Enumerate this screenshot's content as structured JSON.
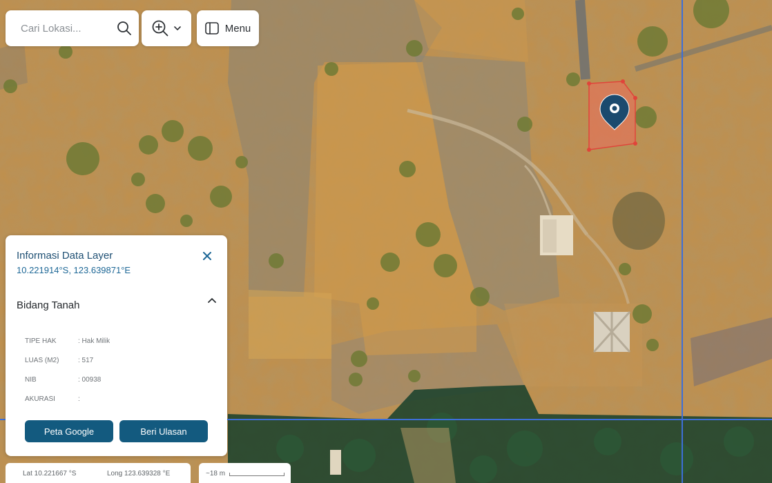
{
  "search": {
    "placeholder": "Cari Lokasi..."
  },
  "toolbar": {
    "menu_label": "Menu"
  },
  "icons": {
    "search": "search-icon",
    "zoom": "zoom-in-icon",
    "dropdown": "chevron-down-icon",
    "sidebar": "sidebar-panel-icon",
    "close": "close-icon",
    "collapse": "chevron-up-icon",
    "marker": "location-pin-icon"
  },
  "panel": {
    "title": "Informasi Data Layer",
    "coords": "10.221914°S, 123.639871°E",
    "section_title": "Bidang Tanah",
    "attributes": [
      {
        "label": "TIPE HAK",
        "value": ": Hak Milik"
      },
      {
        "label": "LUAS (M2)",
        "value": ": 517"
      },
      {
        "label": "NIB",
        "value": ": 00938"
      },
      {
        "label": "AKURASI",
        "value": ":"
      }
    ],
    "buttons": {
      "google": "Peta Google",
      "review": "Beri Ulasan"
    }
  },
  "status": {
    "lat": "Lat 10.221667 °S",
    "long": "Long 123.639328 °E",
    "scale": "~18 m"
  },
  "colors": {
    "accent": "#135a7f",
    "title": "#1e4f73",
    "coords": "#1d6796",
    "parcel_fill": "#e8705c",
    "parcel_stroke": "#e0443a",
    "marker": "#1b4a6e",
    "grid_line": "#3d6fd8"
  }
}
